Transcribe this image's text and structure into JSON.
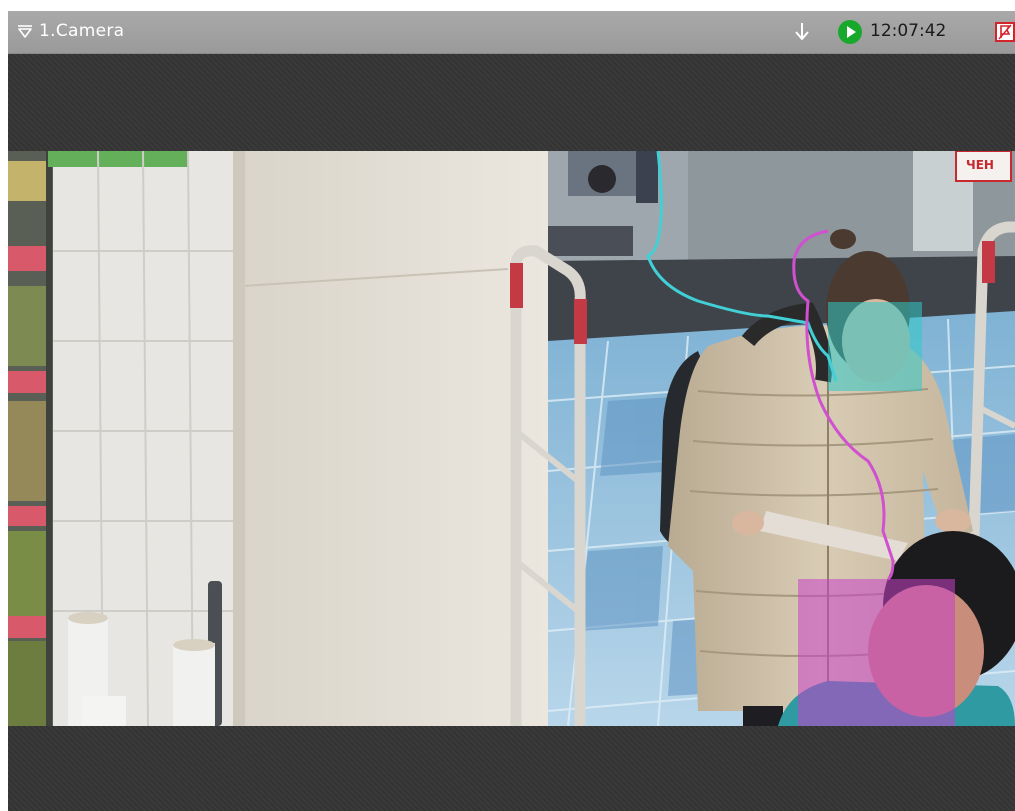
{
  "camera": {
    "name": "1.Camera",
    "time": "12:07:42"
  },
  "icons": {
    "menu": "menu-triangle-icon",
    "export": "export-arrow-icon",
    "play": "play-icon",
    "alarm": "alarm-flag-icon"
  },
  "scene": {
    "door_sign_text": "ЧЕН"
  },
  "colors": {
    "titlebar": "#a0a0a0",
    "play_green": "#17a82c",
    "alarm_red": "#d4232a",
    "face_track_cyan": "#30c8c8",
    "face_track_magenta": "#c840c8"
  }
}
